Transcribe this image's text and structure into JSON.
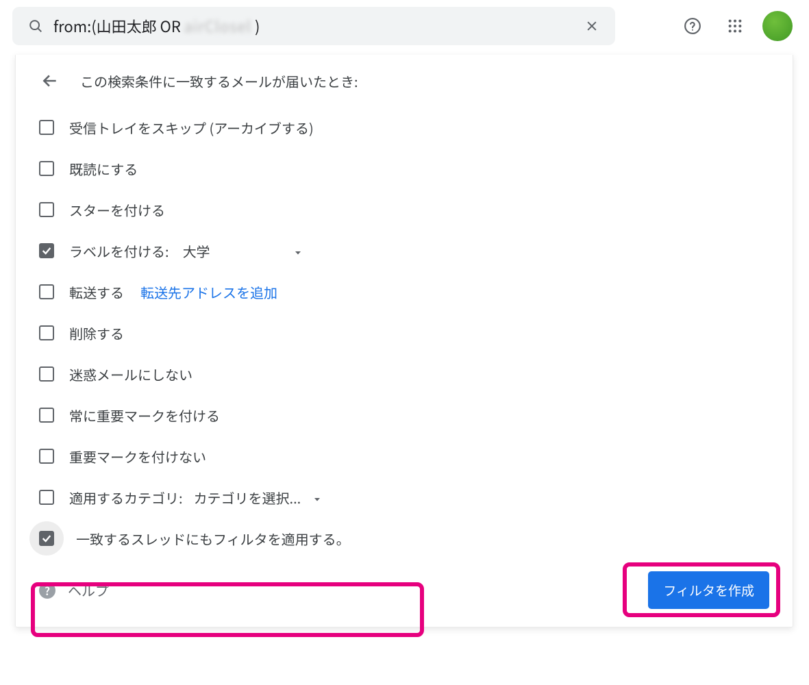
{
  "search": {
    "prefix": "from:(山田太郎 OR ",
    "blurred_term": "airClosel",
    "suffix": " )"
  },
  "panel": {
    "title": "この検索条件に一致するメールが届いたとき:"
  },
  "options": {
    "skip_inbox": "受信トレイをスキップ (アーカイブする)",
    "mark_read": "既読にする",
    "star": "スターを付ける",
    "apply_label_prefix": "ラベルを付ける:",
    "apply_label_value": "大学",
    "forward": "転送する",
    "forward_link": "転送先アドレスを追加",
    "delete": "削除する",
    "never_spam": "迷惑メールにしない",
    "always_important": "常に重要マークを付ける",
    "never_important": "重要マークを付けない",
    "category_prefix": "適用するカテゴリ:",
    "category_value": "カテゴリを選択...",
    "apply_to_threads": "一致するスレッドにもフィルタを適用する。"
  },
  "footer": {
    "help": "ヘルプ",
    "create_button": "フィルタを作成"
  }
}
